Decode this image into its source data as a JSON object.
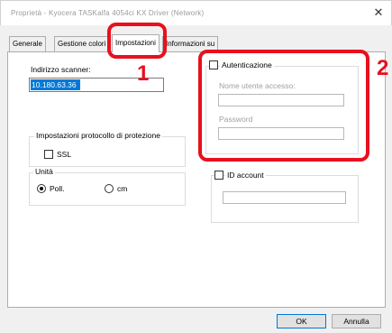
{
  "window": {
    "title": "Proprietà - Kyocera TASKalfa 4054ci KX Driver (Network)",
    "close_glyph": "✕"
  },
  "tabs": [
    {
      "label": "Generale"
    },
    {
      "label": "Gestione colori"
    },
    {
      "label": "Impostazioni",
      "active": true
    },
    {
      "label": "Informazioni su"
    }
  ],
  "settings": {
    "scanner_address_label": "Indirizzo scanner:",
    "scanner_address_value": "10.180.63.36",
    "protocol_group_label": "Impostazioni protocollo di protezione",
    "ssl_label": "SSL",
    "ssl_checked": false,
    "units_group_label": "Unità",
    "unit_options": [
      {
        "label": "Poll.",
        "selected": true
      },
      {
        "label": "cm",
        "selected": false
      }
    ],
    "authentication_label": "Autenticazione",
    "authentication_checked": false,
    "username_label": "Nome utente accesso:",
    "username_value": "",
    "password_label": "Password",
    "password_value": "",
    "account_id_label": "ID account",
    "account_id_checked": false,
    "account_id_value": ""
  },
  "buttons": {
    "ok": "OK",
    "cancel": "Annulla"
  },
  "callouts": [
    {
      "number": "1"
    },
    {
      "number": "2"
    }
  ],
  "colors": {
    "callout": "#e8101e",
    "selection": "#0078d7"
  }
}
